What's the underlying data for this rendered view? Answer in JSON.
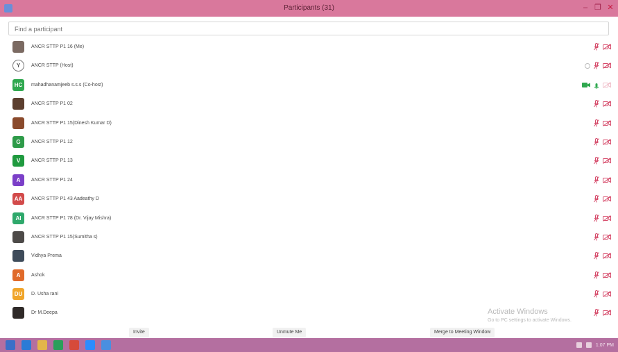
{
  "window": {
    "title": "Participants (31)"
  },
  "window_buttons": {
    "minimize": "–",
    "restore": "❐",
    "close": "✕"
  },
  "search": {
    "placeholder": "Find a participant"
  },
  "participants": [
    {
      "name": "ANCR STTP P1 16 (Me)",
      "avatar": {
        "type": "photo",
        "text": "",
        "color": "#7b6a62"
      },
      "video_on": false,
      "mic_on": false
    },
    {
      "name": "ANCR STTP (Host)",
      "avatar": {
        "type": "outline",
        "text": "Y",
        "color": "#ffffff"
      },
      "video_on": false,
      "mic_on": false,
      "dim_icon": true
    },
    {
      "name": "mahadhanamjeeb s.s.s (Co-host)",
      "avatar": {
        "type": "initials",
        "text": "HC",
        "color": "#2fa84f"
      },
      "video_on": true,
      "mic_on": true
    },
    {
      "name": "ANCR STTP P1 02",
      "avatar": {
        "type": "photo",
        "text": "",
        "color": "#5c3f2f"
      },
      "video_on": false,
      "mic_on": false
    },
    {
      "name": "ANCR STTP P1 15(Dinesh Kumar D)",
      "avatar": {
        "type": "photo",
        "text": "",
        "color": "#8a4a2c"
      },
      "video_on": false,
      "mic_on": false
    },
    {
      "name": "ANCR STTP P1 12",
      "avatar": {
        "type": "initials",
        "text": "G",
        "color": "#2e9b49"
      },
      "video_on": false,
      "mic_on": false
    },
    {
      "name": "ANCR STTP P1 13",
      "avatar": {
        "type": "initials",
        "text": "V",
        "color": "#1f9a3f"
      },
      "video_on": false,
      "mic_on": false
    },
    {
      "name": "ANCR STTP P1 24",
      "avatar": {
        "type": "initials",
        "text": "A",
        "color": "#7b3fc8"
      },
      "video_on": false,
      "mic_on": false
    },
    {
      "name": "ANCR STTP P1 43 Aadeathy D",
      "avatar": {
        "type": "initials",
        "text": "AA",
        "color": "#d24a4a"
      },
      "video_on": false,
      "mic_on": false
    },
    {
      "name": "ANCR STTP P1 78 (Dr. Vijay Mishra)",
      "avatar": {
        "type": "initials",
        "text": "AI",
        "color": "#2ea86b"
      },
      "video_on": false,
      "mic_on": false
    },
    {
      "name": "ANCR STTP P1 15(Sumitha s)",
      "avatar": {
        "type": "photo",
        "text": "",
        "color": "#4d4a48"
      },
      "video_on": false,
      "mic_on": false
    },
    {
      "name": "Vidhya Prema",
      "avatar": {
        "type": "photo",
        "text": "",
        "color": "#3e4b5a"
      },
      "video_on": false,
      "mic_on": false
    },
    {
      "name": "Ashok",
      "avatar": {
        "type": "initials",
        "text": "A",
        "color": "#e06a2a"
      },
      "video_on": false,
      "mic_on": false
    },
    {
      "name": "D. Usha rani",
      "avatar": {
        "type": "initials",
        "text": "DU",
        "color": "#f0a52a"
      },
      "video_on": false,
      "mic_on": false
    },
    {
      "name": "Dr M.Deepa",
      "avatar": {
        "type": "photo",
        "text": "",
        "color": "#2f2a28"
      },
      "video_on": false,
      "mic_on": false
    }
  ],
  "footer": {
    "invite": "Invite",
    "unmute_me": "Unmute Me",
    "merge": "Merge to Meeting Window"
  },
  "watermark": {
    "line1": "Activate Windows",
    "line2": "Go to PC settings to activate Windows."
  },
  "taskbar": {
    "time": "1:07 PM",
    "apps": [
      {
        "icon": "windows-start-icon",
        "color": "#3b6fc7"
      },
      {
        "icon": "ie-browser-icon",
        "color": "#2b7bd6"
      },
      {
        "icon": "file-explorer-icon",
        "color": "#e3b54a"
      },
      {
        "icon": "media-player-icon",
        "color": "#2a9f5a"
      },
      {
        "icon": "chrome-icon",
        "color": "#d64a3a"
      },
      {
        "icon": "zoom-app-icon",
        "color": "#2d8cff"
      },
      {
        "icon": "zoom-meeting-icon",
        "color": "#4a8fe0"
      }
    ]
  },
  "colors": {
    "titlebar": "#d9789c",
    "muted_icon": "#d64a6a",
    "video_on": "#2fa84f",
    "taskbar": "#b46fa0"
  }
}
